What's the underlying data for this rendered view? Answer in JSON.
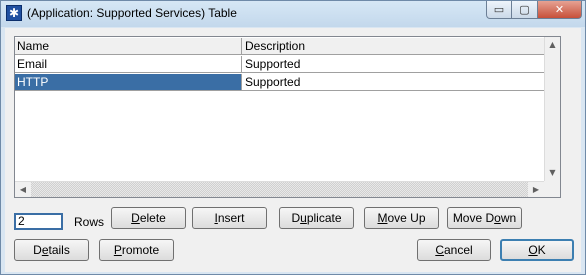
{
  "window": {
    "title": "(Application: Supported Services) Table",
    "icon": "app-star-icon",
    "caption_buttons": {
      "minimize": "▭",
      "maximize": "▢",
      "close": "✕"
    }
  },
  "table": {
    "columns": [
      "Name",
      "Description"
    ],
    "rows": [
      {
        "name": "Email",
        "description": "Supported",
        "selected": false
      },
      {
        "name": "HTTP",
        "description": "Supported",
        "selected": true
      }
    ],
    "selection_color": "#3a6ea5"
  },
  "rows_control": {
    "value": "2",
    "label": "Rows"
  },
  "buttons": {
    "delete": {
      "label": "Delete",
      "accel": "D",
      "rest": "elete"
    },
    "insert": {
      "label": "Insert",
      "accel": "I",
      "rest": "nsert"
    },
    "duplicate": {
      "label": "Duplicate",
      "pre": "D",
      "accel": "u",
      "rest": "plicate"
    },
    "move_up": {
      "label": "Move Up",
      "accel": "M",
      "rest": "ove Up"
    },
    "move_down": {
      "label": "Move Down",
      "pre": "Move D",
      "accel": "o",
      "rest": "wn"
    },
    "details": {
      "label": "Details",
      "pre": "D",
      "accel": "e",
      "rest": "tails"
    },
    "promote": {
      "label": "Promote",
      "accel": "P",
      "rest": "romote"
    },
    "cancel": {
      "label": "Cancel",
      "accel": "C",
      "rest": "ancel"
    },
    "ok": {
      "label": "OK",
      "accel": "O",
      "rest": "K"
    }
  }
}
